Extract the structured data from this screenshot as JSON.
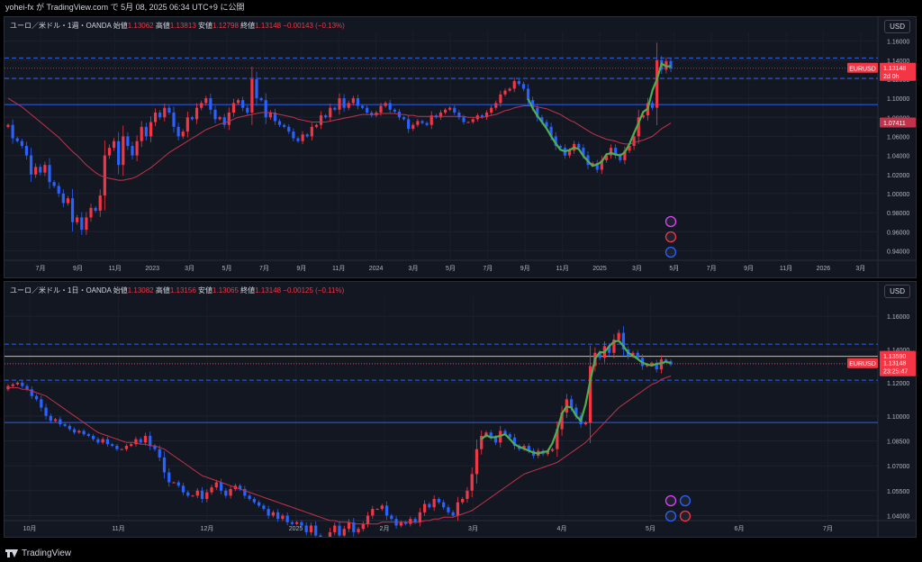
{
  "header": {
    "author": "yohei-fx",
    "middle": "が TradingView.com で",
    "date": "5月 08, 2025 06:34 UTC+9",
    "suffix": "に公開"
  },
  "footer": {
    "brand": "TradingView"
  },
  "colors": {
    "up": "#f23645",
    "down": "#2962ff",
    "ma": "#c2334b",
    "wave": "#4caf50",
    "hline_blue": "#2962ff",
    "hline_yellow": "#f5c518",
    "zone": "#f5e93b"
  },
  "chart_data": [
    {
      "type": "candlestick",
      "legend": {
        "title": "ユーロ／米ドル・1週・OANDA",
        "open_label": "始値",
        "open": "1.13062",
        "high_label": "高値",
        "high": "1.13813",
        "low_label": "安値",
        "low": "1.12798",
        "close_label": "終値",
        "close": "1.13148",
        "change": "−0.00143 (−0.13%)"
      },
      "currency": "USD",
      "ylim": [
        0.93,
        1.17
      ],
      "y_ticks": [
        "1.16000",
        "1.14000",
        "1.12000",
        "1.10000",
        "1.08000",
        "1.06000",
        "1.04000",
        "1.02000",
        "1.00000",
        "0.98000",
        "0.96000",
        "0.94000"
      ],
      "x_ticks": [
        "7月",
        "9月",
        "11月",
        "2023",
        "3月",
        "5月",
        "7月",
        "9月",
        "11月",
        "2024",
        "3月",
        "5月",
        "7月",
        "9月",
        "11月",
        "2025",
        "3月",
        "5月",
        "7月",
        "9月",
        "11月",
        "2026",
        "3月"
      ],
      "price_label": {
        "symbol": "EURUSD",
        "value": "1.13148",
        "countdown": "2d 0h"
      },
      "ma_label": "1.07411",
      "hlines": [
        {
          "value": 1.1423,
          "style": "dashed"
        },
        {
          "value": 1.1209,
          "style": "dashed"
        },
        {
          "value": 1.0934,
          "style": "solid"
        }
      ],
      "closes": [
        1.072,
        1.058,
        1.055,
        1.05,
        1.04,
        1.02,
        1.028,
        1.022,
        1.03,
        1.012,
        1.008,
        1.0,
        0.99,
        0.995,
        0.97,
        0.975,
        0.962,
        0.975,
        0.985,
        0.982,
        0.998,
        1.04,
        1.048,
        1.055,
        1.03,
        1.06,
        1.05,
        1.04,
        1.055,
        1.07,
        1.06,
        1.075,
        1.085,
        1.08,
        1.09,
        1.085,
        1.07,
        1.06,
        1.065,
        1.08,
        1.078,
        1.09,
        1.095,
        1.1,
        1.088,
        1.078,
        1.08,
        1.072,
        1.085,
        1.095,
        1.098,
        1.09,
        1.085,
        1.12,
        1.1,
        1.098,
        1.08,
        1.085,
        1.076,
        1.072,
        1.07,
        1.065,
        1.058,
        1.055,
        1.062,
        1.06,
        1.07,
        1.072,
        1.082,
        1.08,
        1.09,
        1.088,
        1.1,
        1.09,
        1.095,
        1.1,
        1.092,
        1.09,
        1.085,
        1.082,
        1.085,
        1.092,
        1.095,
        1.088,
        1.086,
        1.08,
        1.078,
        1.068,
        1.072,
        1.076,
        1.074,
        1.072,
        1.082,
        1.08,
        1.085,
        1.088,
        1.09,
        1.085,
        1.08,
        1.075,
        1.075,
        1.078,
        1.082,
        1.08,
        1.085,
        1.09,
        1.095,
        1.104,
        1.108,
        1.11,
        1.118,
        1.115,
        1.11,
        1.098,
        1.09,
        1.08,
        1.075,
        1.07,
        1.06,
        1.05,
        1.048,
        1.04,
        1.045,
        1.052,
        1.048,
        1.04,
        1.03,
        1.032,
        1.025,
        1.035,
        1.04,
        1.048,
        1.04,
        1.035,
        1.045,
        1.05,
        1.06,
        1.08,
        1.082,
        1.095,
        1.09,
        1.14,
        1.13,
        1.139,
        1.131
      ],
      "ma": [
        1.1,
        1.097,
        1.094,
        1.091,
        1.087,
        1.083,
        1.079,
        1.075,
        1.071,
        1.067,
        1.063,
        1.059,
        1.054,
        1.049,
        1.044,
        1.04,
        1.035,
        1.03,
        1.026,
        1.022,
        1.019,
        1.017,
        1.016,
        1.015,
        1.014,
        1.014,
        1.015,
        1.016,
        1.018,
        1.021,
        1.024,
        1.027,
        1.031,
        1.035,
        1.039,
        1.043,
        1.046,
        1.049,
        1.052,
        1.055,
        1.058,
        1.061,
        1.064,
        1.067,
        1.069,
        1.071,
        1.073,
        1.074,
        1.076,
        1.078,
        1.08,
        1.081,
        1.082,
        1.083,
        1.084,
        1.085,
        1.085,
        1.085,
        1.084,
        1.083,
        1.082,
        1.081,
        1.08,
        1.078,
        1.077,
        1.076,
        1.075,
        1.075,
        1.075,
        1.075,
        1.076,
        1.077,
        1.078,
        1.079,
        1.08,
        1.081,
        1.082,
        1.083,
        1.083,
        1.083,
        1.083,
        1.084,
        1.084,
        1.084,
        1.084,
        1.083,
        1.083,
        1.082,
        1.082,
        1.081,
        1.081,
        1.081,
        1.081,
        1.081,
        1.081,
        1.081,
        1.081,
        1.081,
        1.081,
        1.081,
        1.08,
        1.08,
        1.08,
        1.08,
        1.081,
        1.082,
        1.083,
        1.085,
        1.087,
        1.088,
        1.09,
        1.091,
        1.092,
        1.092,
        1.092,
        1.091,
        1.09,
        1.089,
        1.087,
        1.085,
        1.083,
        1.08,
        1.077,
        1.075,
        1.072,
        1.069,
        1.066,
        1.063,
        1.061,
        1.059,
        1.057,
        1.056,
        1.055,
        1.053,
        1.052,
        1.052,
        1.053,
        1.055,
        1.056,
        1.058,
        1.06,
        1.064,
        1.068,
        1.071,
        1.074
      ]
    },
    {
      "type": "candlestick",
      "legend": {
        "title": "ユーロ／米ドル・1日・OANDA",
        "open_label": "始値",
        "open": "1.13082",
        "high_label": "高値",
        "high": "1.13156",
        "low_label": "安値",
        "low": "1.13065",
        "close_label": "終値",
        "close": "1.13148",
        "change": "−0.00125 (−0.11%)"
      },
      "currency": "USD",
      "ylim": [
        1.037,
        1.172
      ],
      "y_ticks": [
        "1.16000",
        "1.14000",
        "1.12000",
        "1.10000",
        "1.08500",
        "1.07000",
        "1.05500",
        "1.04000"
      ],
      "x_ticks": [
        "10月",
        "11月",
        "12月",
        "2025",
        "2月",
        "3月",
        "4月",
        "5月",
        "6月",
        "7月"
      ],
      "price_label": {
        "symbol": "EURUSD",
        "value": "1.13148",
        "countdown": "23:25:47"
      },
      "upper_label": "1.13590",
      "hlines": [
        {
          "value": 1.1432,
          "style": "dashed",
          "color": "blue"
        },
        {
          "value": 1.1359,
          "style": "solid",
          "color": "yellow"
        },
        {
          "value": 1.1314,
          "style": "dotted",
          "color": "red"
        },
        {
          "value": 1.1215,
          "style": "dashed",
          "color": "blue"
        },
        {
          "value": 1.096,
          "style": "solid",
          "color": "blue"
        }
      ],
      "zone": {
        "from": 1.1105,
        "to": 1.1235
      },
      "closes": [
        1.118,
        1.119,
        1.12,
        1.118,
        1.116,
        1.112,
        1.11,
        1.105,
        1.1,
        1.097,
        1.098,
        1.095,
        1.094,
        1.092,
        1.09,
        1.091,
        1.089,
        1.088,
        1.086,
        1.084,
        1.086,
        1.083,
        1.082,
        1.08,
        1.08,
        1.082,
        1.083,
        1.086,
        1.084,
        1.088,
        1.082,
        1.08,
        1.075,
        1.066,
        1.06,
        1.06,
        1.058,
        1.054,
        1.052,
        1.052,
        1.055,
        1.05,
        1.054,
        1.057,
        1.06,
        1.055,
        1.052,
        1.056,
        1.058,
        1.056,
        1.052,
        1.05,
        1.048,
        1.046,
        1.044,
        1.04,
        1.042,
        1.038,
        1.04,
        1.036,
        1.035,
        1.036,
        1.034,
        1.03,
        1.034,
        1.028,
        1.026,
        1.024,
        1.03,
        1.034,
        1.028,
        1.032,
        1.036,
        1.03,
        1.032,
        1.035,
        1.04,
        1.044,
        1.044,
        1.046,
        1.04,
        1.038,
        1.034,
        1.036,
        1.035,
        1.038,
        1.036,
        1.042,
        1.047,
        1.045,
        1.05,
        1.048,
        1.045,
        1.042,
        1.04,
        1.048,
        1.05,
        1.055,
        1.065,
        1.08,
        1.088,
        1.09,
        1.087,
        1.084,
        1.091,
        1.089,
        1.087,
        1.082,
        1.08,
        1.082,
        1.079,
        1.076,
        1.079,
        1.077,
        1.079,
        1.08,
        1.092,
        1.102,
        1.11,
        1.105,
        1.1,
        1.095,
        1.096,
        1.13,
        1.138,
        1.135,
        1.142,
        1.138,
        1.146,
        1.15,
        1.14,
        1.136,
        1.138,
        1.135,
        1.13,
        1.131,
        1.132,
        1.128,
        1.134,
        1.133,
        1.131
      ],
      "ma": [
        1.117,
        1.117,
        1.117,
        1.116,
        1.116,
        1.115,
        1.114,
        1.113,
        1.112,
        1.11,
        1.108,
        1.106,
        1.104,
        1.102,
        1.1,
        1.098,
        1.096,
        1.094,
        1.092,
        1.09,
        1.089,
        1.088,
        1.087,
        1.086,
        1.085,
        1.084,
        1.084,
        1.084,
        1.083,
        1.083,
        1.082,
        1.082,
        1.081,
        1.08,
        1.078,
        1.076,
        1.074,
        1.072,
        1.07,
        1.068,
        1.066,
        1.064,
        1.063,
        1.062,
        1.061,
        1.06,
        1.059,
        1.058,
        1.057,
        1.056,
        1.055,
        1.054,
        1.053,
        1.052,
        1.051,
        1.05,
        1.049,
        1.048,
        1.047,
        1.046,
        1.045,
        1.044,
        1.043,
        1.042,
        1.041,
        1.04,
        1.039,
        1.038,
        1.037,
        1.037,
        1.036,
        1.036,
        1.036,
        1.035,
        1.035,
        1.035,
        1.035,
        1.035,
        1.035,
        1.036,
        1.036,
        1.036,
        1.036,
        1.036,
        1.036,
        1.036,
        1.036,
        1.036,
        1.037,
        1.037,
        1.038,
        1.038,
        1.039,
        1.039,
        1.039,
        1.04,
        1.041,
        1.042,
        1.043,
        1.045,
        1.047,
        1.049,
        1.051,
        1.053,
        1.055,
        1.057,
        1.059,
        1.061,
        1.063,
        1.065,
        1.066,
        1.067,
        1.068,
        1.069,
        1.07,
        1.071,
        1.072,
        1.074,
        1.076,
        1.078,
        1.08,
        1.082,
        1.084,
        1.087,
        1.09,
        1.093,
        1.096,
        1.099,
        1.102,
        1.105,
        1.107,
        1.109,
        1.111,
        1.113,
        1.115,
        1.117,
        1.119,
        1.12,
        1.122,
        1.123,
        1.124
      ]
    }
  ]
}
